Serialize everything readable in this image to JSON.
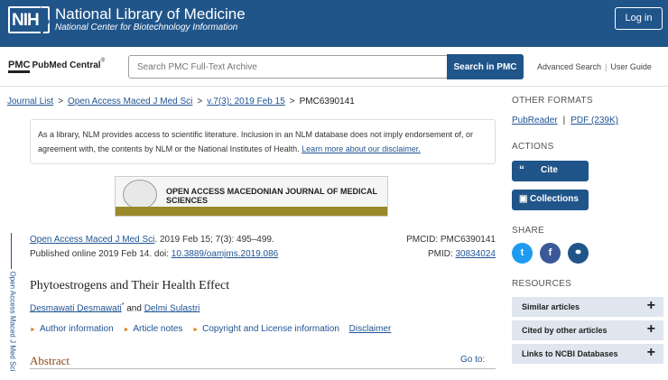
{
  "header": {
    "logo_text": "NIH",
    "title": "National Library of Medicine",
    "subtitle": "National Center for Biotechnology Information",
    "login_label": "Log in"
  },
  "searchbar": {
    "logo_box": "PMC",
    "logo_name": "PubMed Central",
    "logo_reg": "®",
    "placeholder": "Search PMC Full-Text Archive",
    "button_label": "Search in PMC",
    "advanced_label": "Advanced Search",
    "separator": "|",
    "guide_label": "User Guide"
  },
  "breadcrumb": {
    "items": [
      "Journal List",
      "Open Access Maced J Med Sci",
      "v.7(3); 2019 Feb 15"
    ],
    "current": "PMC6390141",
    "separator": ">"
  },
  "disclaimer": {
    "text": "As a library, NLM provides access to scientific literature. Inclusion in an NLM database does not imply endorsement of, or agreement with, the contents by NLM or the National Institutes of Health.",
    "link": "Learn more about our disclaimer."
  },
  "banner": {
    "text": "OPEN ACCESS MACEDONIAN JOURNAL OF MEDICAL SCIENCES"
  },
  "side_label": "Open Access Maced J Med Sci",
  "citation": {
    "journal_link": "Open Access Maced J Med Sci",
    "journal_rest": ". 2019 Feb 15; 7(3): 495–499.",
    "published": "Published online 2019 Feb 14. doi: ",
    "doi": "10.3889/oamjms.2019.086",
    "pmcid_label": "PMCID: PMC6390141",
    "pmid_label": "PMID: ",
    "pmid": "30834024"
  },
  "article": {
    "title": "Phytoestrogens and Their Health Effect",
    "author1": "Desmawati Desmawati",
    "author1_sup": "*",
    "and": " and ",
    "author2": "Delmi Sulastri",
    "links": [
      "Author information",
      "Article notes",
      "Copyright and License information",
      "Disclaimer"
    ],
    "tri": "►"
  },
  "abstract": {
    "heading": "Abstract",
    "goto": "Go to:"
  },
  "right_panel": {
    "other_formats_head": "OTHER FORMATS",
    "pubreader": "PubReader",
    "pdf": "PDF (239K)",
    "fmt_sep": "|",
    "actions_head": "ACTIONS",
    "cite_label": "Cite",
    "cite_icon": "“",
    "collections_label": "Collections",
    "collections_icon": "▣",
    "share_head": "SHARE",
    "share_twitter": "t",
    "share_facebook": "f",
    "share_link": "⚭",
    "resources_head": "RESOURCES",
    "resources": [
      "Similar articles",
      "Cited by other articles",
      "Links to NCBI Databases"
    ],
    "plus": "+"
  },
  "colors": {
    "header_bg": "#20558a",
    "link": "#205493",
    "resource_bg": "#dfe6ef",
    "twitter": "#1d9bf0",
    "facebook": "#3b5998",
    "copy": "#20558a",
    "abstract_heading": "#8b4513"
  }
}
